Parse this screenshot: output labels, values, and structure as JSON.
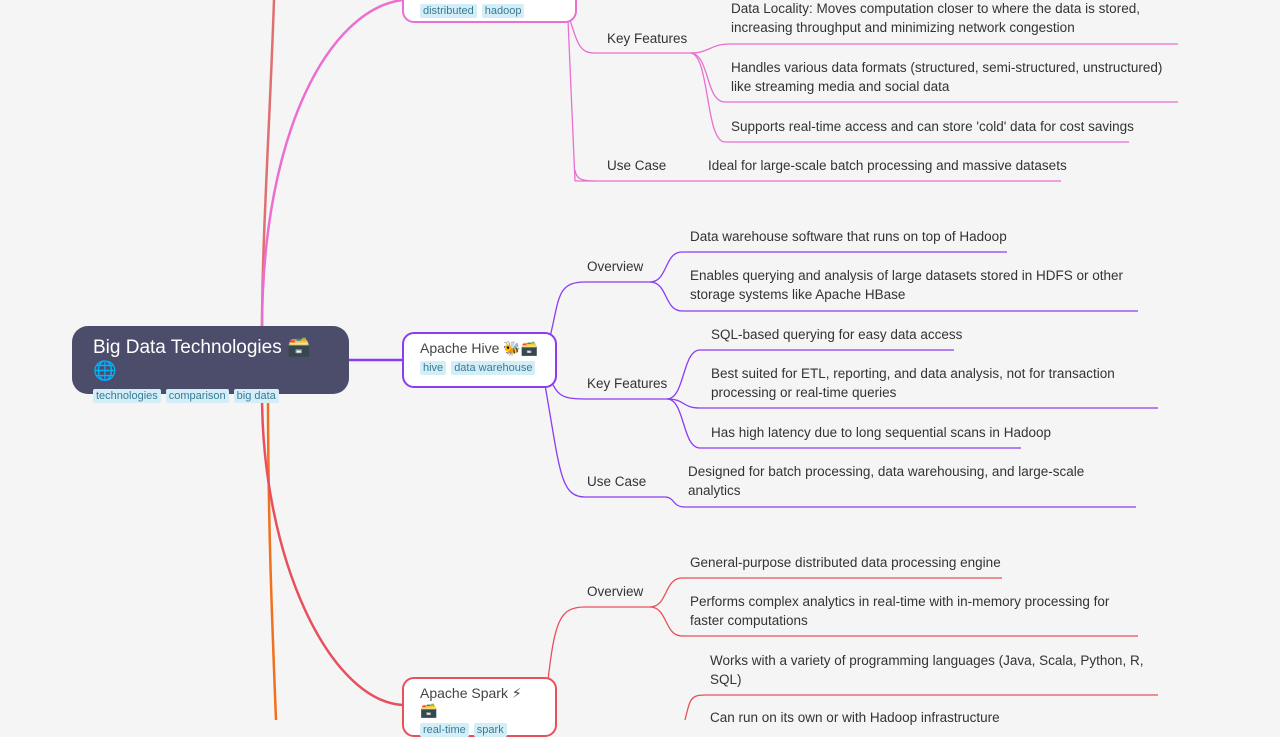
{
  "root": {
    "title": "Big Data Technologies 🗃️🌐",
    "tags": [
      "technologies",
      "comparison",
      "big data"
    ]
  },
  "hadoop": {
    "tags": [
      "distributed",
      "hadoop"
    ],
    "key_features_label": "Key Features",
    "key_features": [
      "Data Locality: Moves computation closer to where the data is stored,|increasing throughput and minimizing network congestion",
      "Handles various data formats (structured, semi-structured, unstructured)|like streaming media and social data",
      "Supports real-time access and can store 'cold' data for cost savings"
    ],
    "use_case_label": "Use Case",
    "use_case": "Ideal for large-scale batch processing and massive datasets"
  },
  "hive": {
    "title": "Apache Hive 🐝🗃️",
    "tags": [
      "hive",
      "data warehouse"
    ],
    "overview_label": "Overview",
    "overview": [
      "Data warehouse software that runs on top of Hadoop",
      "Enables querying and analysis of large datasets stored in HDFS or other|storage systems like Apache HBase"
    ],
    "key_features_label": "Key Features",
    "key_features": [
      "SQL-based querying for easy data access",
      "Best suited for ETL, reporting, and data analysis, not for transaction|processing or real-time queries",
      "Has high latency due to long sequential scans in Hadoop"
    ],
    "use_case_label": "Use Case",
    "use_case": "Designed for batch processing, data warehousing, and large-scale|analytics"
  },
  "spark": {
    "title": "Apache Spark ⚡🗃️",
    "tags": [
      "real-time",
      "spark"
    ],
    "overview_label": "Overview",
    "overview": [
      "General-purpose distributed data processing engine",
      "Performs complex analytics in real-time with in-memory processing for|faster computations"
    ],
    "key_features": [
      "Works with a variety of programming languages (Java, Scala, Python, R,|SQL)",
      "Can run on its own or with Hadoop infrastructure"
    ]
  },
  "colors": {
    "hadoop": "#ea6fd0",
    "hive": "#8b3cf0",
    "spark": "#e8505b",
    "other": "#f07020",
    "root_bg": "#4b4d6a"
  }
}
